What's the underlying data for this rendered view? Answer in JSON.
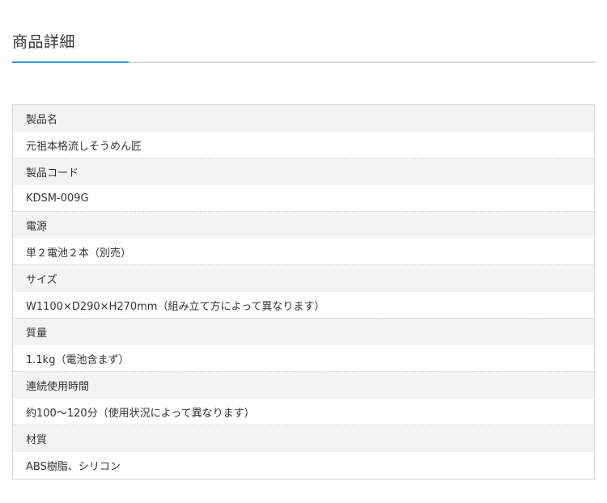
{
  "section": {
    "title": "商品詳細"
  },
  "specs": [
    {
      "label": "製品名",
      "value": "元祖本格流しそうめん匠"
    },
    {
      "label": "製品コード",
      "value": "KDSM-009G"
    },
    {
      "label": "電源",
      "value": "単２電池２本（別売）"
    },
    {
      "label": "サイズ",
      "value": "W1100×D290×H270mm（組み立て方によって異なります）"
    },
    {
      "label": "質量",
      "value": "1.1kg（電池含まず）"
    },
    {
      "label": "連続使用時間",
      "value": "約100～120分（使用状況によって異なります）"
    },
    {
      "label": "材質",
      "value": "ABS樹脂、シリコン"
    }
  ],
  "colors": {
    "accent": "#3d8fd6",
    "label_bg": "#f3f3f3",
    "border": "#d6d6d6"
  }
}
